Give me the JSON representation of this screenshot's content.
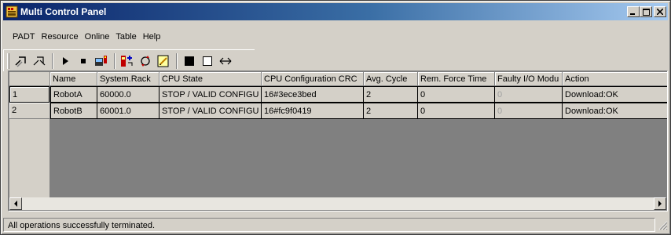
{
  "window": {
    "title": "Multi Control Panel"
  },
  "titlebar_buttons": {
    "minimize": "_",
    "maximize": "□",
    "close": "✕"
  },
  "menu": [
    "PADT",
    "Resource",
    "Online",
    "Table",
    "Help"
  ],
  "toolbar": {
    "tools": [
      "connect-icon",
      "disconnect-icon",
      "play-icon",
      "stop-icon",
      "download-icon",
      "reset-icon",
      "refresh-icon",
      "edit-icon",
      "filled-square-icon",
      "empty-square-icon",
      "arrows-icon"
    ]
  },
  "table": {
    "columns": [
      "Name",
      "System.Rack",
      "CPU State",
      "CPU Configuration CRC",
      "Avg. Cycle",
      "Rem. Force Time",
      "Faulty I/O Modu",
      "Action"
    ],
    "rows": [
      {
        "index": "1",
        "cells": [
          "RobotA",
          "60000.0",
          "STOP / VALID CONFIGU",
          "16#3ece3bed",
          "2",
          "0",
          "0",
          "Download:OK"
        ]
      },
      {
        "index": "2",
        "cells": [
          "RobotB",
          "60001.0",
          "STOP / VALID CONFIGU",
          "16#fc9f0419",
          "2",
          "0",
          "0",
          "Download:OK"
        ]
      }
    ]
  },
  "status": {
    "text": "All operations successfully terminated."
  },
  "colors": {
    "title_start": "#0a246a",
    "title_end": "#a6caf0",
    "face": "#d4d0c8",
    "grid_bg": "#808080"
  }
}
